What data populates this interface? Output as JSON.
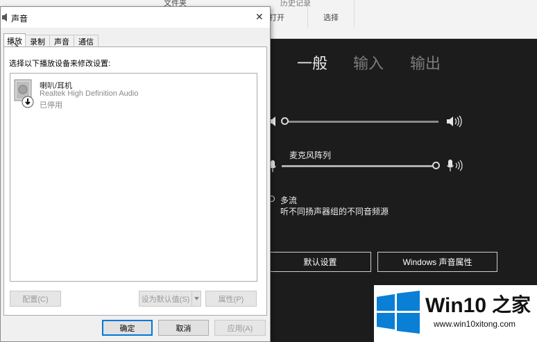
{
  "background": {
    "ribbon": {
      "folder_label": "文件夹",
      "history_label": "历史记录",
      "open_group": "打开",
      "select_group": "选择"
    },
    "settings": {
      "tabs": [
        "一般",
        "输入",
        "输出"
      ],
      "active_tab_index": 0,
      "output_volume_level": 0.0,
      "mic_label": "麦克风阵列",
      "mic_volume_level": 1.0,
      "multistream_label": "多流",
      "multistream_desc": "听不同扬声器组的不同音频源",
      "default_button": "默认设置",
      "windows_props_button": "Windows 声音属性"
    }
  },
  "dialog": {
    "title": "声音",
    "close_glyph": "✕",
    "tabs": [
      "播放",
      "录制",
      "声音",
      "通信"
    ],
    "active_tab_index": 0,
    "instruction": "选择以下播放设备来修改设置:",
    "devices": [
      {
        "name": "喇叭/耳机",
        "driver": "Realtek High Definition Audio",
        "status": "已停用"
      }
    ],
    "buttons": {
      "configure": "配置(C)",
      "set_default": "设为默认值(S)",
      "properties": "属性(P)",
      "ok": "确定",
      "cancel": "取消",
      "apply": "应用(A)"
    }
  },
  "watermark": {
    "brand": "Win10",
    "brand_suffix": "之家",
    "url": "www.win10xitong.com"
  },
  "colors": {
    "win_blue": "#0a7fd6",
    "dark_bg": "#1c1c1c"
  }
}
